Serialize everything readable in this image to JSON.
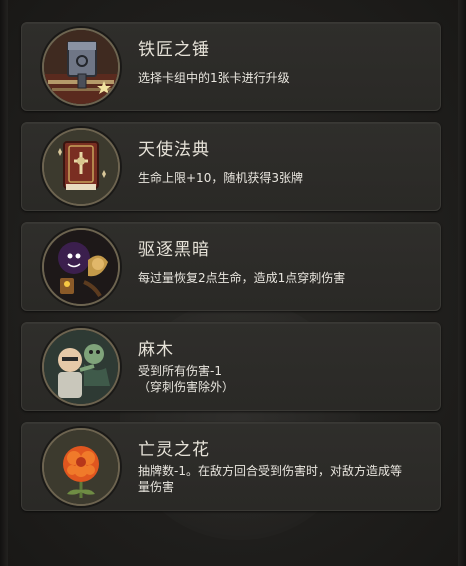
{
  "relics": [
    {
      "icon": "blacksmith-hammer-icon",
      "title": "铁匠之锤",
      "desc_lines": [
        "选择卡组中的1张卡进行升级"
      ]
    },
    {
      "icon": "angel-codex-icon",
      "title": "天使法典",
      "desc_lines": [
        "生命上限+10，随机获得3张牌"
      ]
    },
    {
      "icon": "dispel-darkness-icon",
      "title": "驱逐黑暗",
      "desc_lines": [
        "每过量恢复2点生命，造成1点穿刺伤害"
      ]
    },
    {
      "icon": "numb-icon",
      "title": "麻木",
      "desc_lines": [
        "受到所有伤害-1",
        "（穿刺伤害除外）"
      ]
    },
    {
      "icon": "undead-flower-icon",
      "title": "亡灵之花",
      "desc_lines": [
        "抽牌数-1。在敌方回合受到伤害时，对敌方造成等",
        "量伤害"
      ]
    }
  ],
  "colors": {
    "card_bg": "#2d2c29",
    "ring_border": "#6d6450",
    "title_text": "#e6e2d8",
    "desc_text": "#e9e6df"
  }
}
